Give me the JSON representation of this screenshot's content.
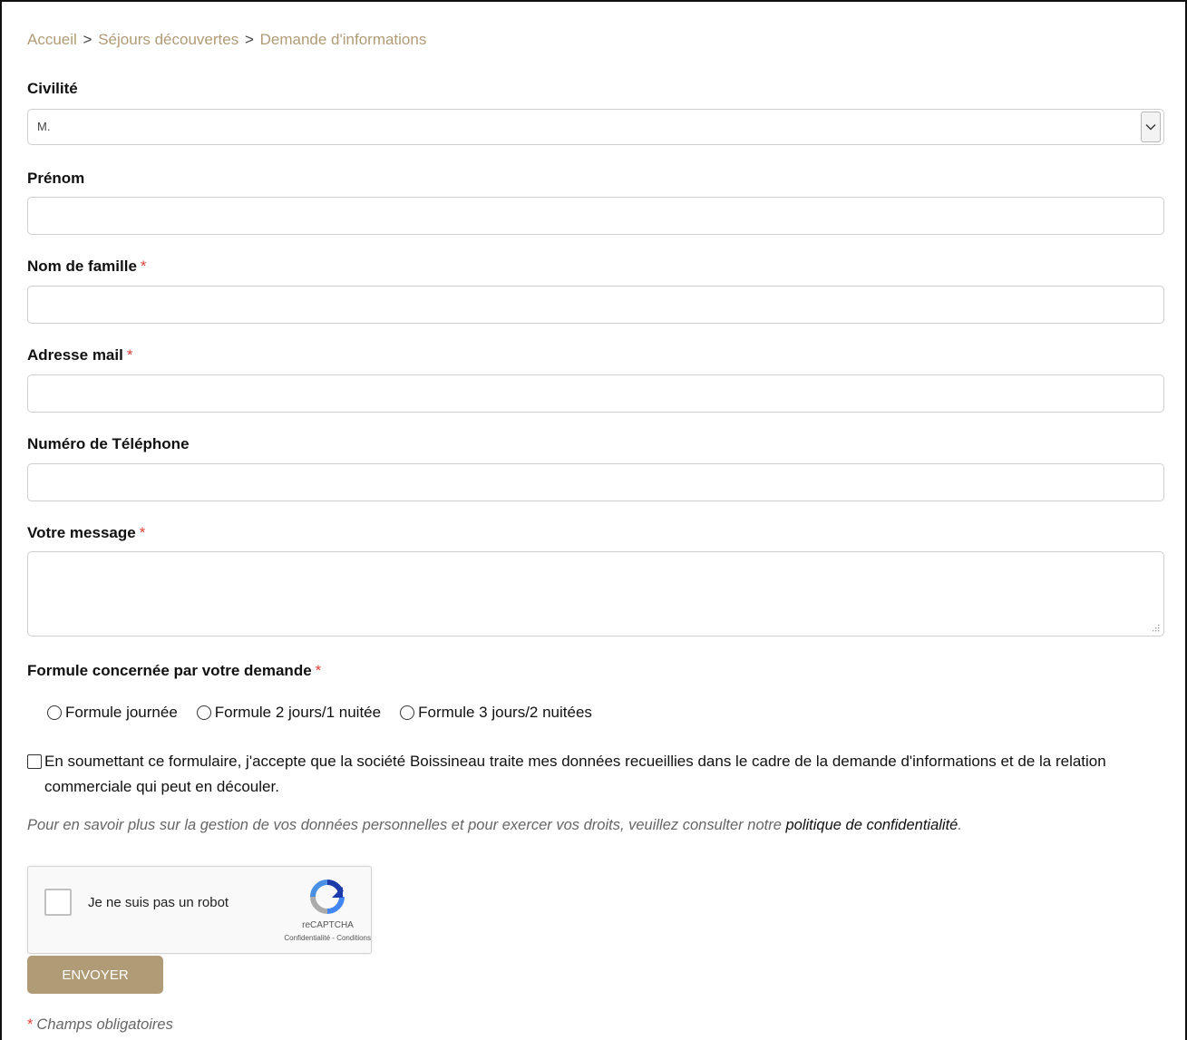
{
  "breadcrumb": {
    "items": [
      "Accueil",
      "Séjours découvertes",
      "Demande d'informations"
    ],
    "separator": ">"
  },
  "required_marker": "*",
  "form": {
    "civilite": {
      "label": "Civilité",
      "value": "M."
    },
    "prenom": {
      "label": "Prénom",
      "value": ""
    },
    "nom": {
      "label": "Nom de famille",
      "value": ""
    },
    "email": {
      "label": "Adresse mail",
      "value": ""
    },
    "telephone": {
      "label": "Numéro de Téléphone",
      "value": ""
    },
    "message": {
      "label": "Votre message",
      "value": ""
    },
    "formule": {
      "label": "Formule concernée par votre demande",
      "options": [
        "Formule journée",
        "Formule 2 jours/1 nuitée",
        "Formule 3 jours/2 nuitées"
      ]
    },
    "consent_text": "En soumettant ce formulaire, j'accepte que la société Boissineau traite mes données recueillies dans le cadre de la demande d'informations et de la relation commerciale qui peut en découler.",
    "privacy_text": "Pour en savoir plus sur la gestion de vos données personnelles et pour exercer vos droits, veuillez consulter notre",
    "privacy_link": "politique de confidentialité",
    "privacy_end": ".",
    "submit_label": "ENVOYER",
    "required_note": "Champs obligatoires"
  },
  "recaptcha": {
    "label": "Je ne suis pas un robot",
    "brand": "reCAPTCHA",
    "privacy": "Confidentialité",
    "terms_sep": "-",
    "terms": "Conditions"
  },
  "colors": {
    "accent": "#b09b77",
    "required": "#e0413b",
    "muted_text": "#666666"
  }
}
